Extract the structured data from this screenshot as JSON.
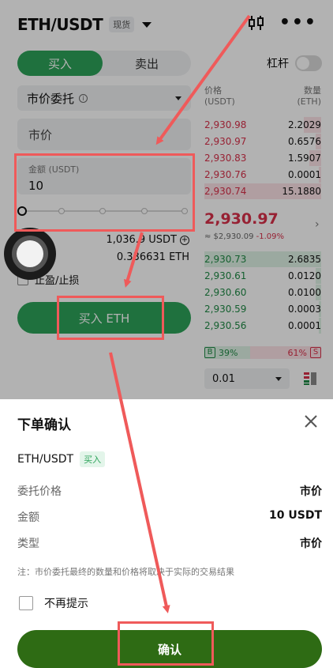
{
  "header": {
    "pair": "ETH/USDT",
    "badge": "现货"
  },
  "trade": {
    "buy_label": "买入",
    "sell_label": "卖出",
    "leverage_label": "杠杆",
    "order_type": "市价委托",
    "info_glyph": "i",
    "market_field": "市价",
    "amount_label": "金额 (USDT)",
    "amount_value": "10",
    "available_usdt": "1,036.9 USDT",
    "available_eth": "0.336631 ETH",
    "plus_glyph": "+",
    "tpsl_label": "止盈/止损",
    "buy_button": "买入 ETH"
  },
  "orderbook": {
    "price_header": "价格",
    "price_unit": "(USDT)",
    "qty_header": "数量",
    "qty_unit": "(ETH)",
    "asks": [
      {
        "price": "2,930.98",
        "qty": "2.2029",
        "depth": 0.15
      },
      {
        "price": "2,930.97",
        "qty": "0.6576",
        "depth": 0.05
      },
      {
        "price": "2,930.83",
        "qty": "1.5907",
        "depth": 0.1
      },
      {
        "price": "2,930.76",
        "qty": "0.0001",
        "depth": 0.02
      },
      {
        "price": "2,930.74",
        "qty": "15.1880",
        "depth": 1.0
      }
    ],
    "last_price": "2,930.97",
    "ref_price": "≈ $2,930.09",
    "change": "-1.09%",
    "chevron": "›",
    "bids": [
      {
        "price": "2,930.73",
        "qty": "2.6835",
        "depth": 1.0
      },
      {
        "price": "2,930.61",
        "qty": "0.0120",
        "depth": 0.05
      },
      {
        "price": "2,930.60",
        "qty": "0.0100",
        "depth": 0.05
      },
      {
        "price": "2,930.59",
        "qty": "0.0003",
        "depth": 0.02
      },
      {
        "price": "2,930.56",
        "qty": "0.0001",
        "depth": 0.02
      }
    ],
    "buy_tag": "B",
    "buy_ratio": "39%",
    "sell_ratio": "61%",
    "sell_tag": "S",
    "precision": "0.01"
  },
  "sheet": {
    "title": "下单确认",
    "pair": "ETH/USDT",
    "side_tag": "买入",
    "rows": [
      {
        "k": "委托价格",
        "v": "市价"
      },
      {
        "k": "金额",
        "v": "10 USDT"
      },
      {
        "k": "类型",
        "v": "市价"
      }
    ],
    "note": "注：市价委托最终的数量和价格将取决于实际的交易结果",
    "no_remind": "不再提示",
    "confirm": "确认"
  },
  "colors": {
    "buy_green": "#2da35a",
    "sell_red": "#d9304a",
    "confirm_green": "#2e6b14",
    "annotation_red": "#ef5a5a"
  }
}
